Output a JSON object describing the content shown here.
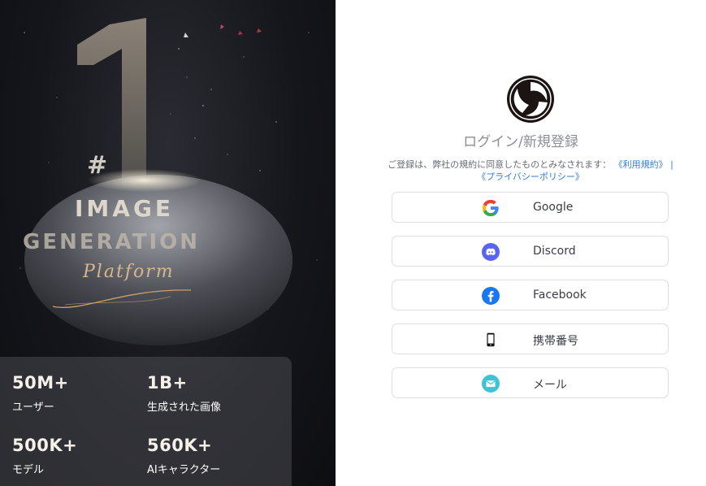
{
  "promo": {
    "hero": {
      "number": "1",
      "hash": "#",
      "line1": "IMAGE",
      "line2": "GENERATION",
      "line3": "Platform"
    },
    "stats": [
      {
        "value": "50M+",
        "label": "ユーザー"
      },
      {
        "value": "1B+",
        "label": "生成された画像"
      },
      {
        "value": "500K+",
        "label": "モデル"
      },
      {
        "value": "560K+",
        "label": "AIキャラクター"
      }
    ]
  },
  "login": {
    "title": "ログイン/新規登録",
    "terms_text": "ご登録は、弊社の規約に同意したものとみなされます：",
    "terms_link": "《利用規約》",
    "separator": " | ",
    "privacy_link": "《プライバシーポリシー》",
    "buttons": [
      {
        "label": "Google",
        "icon": "google-icon"
      },
      {
        "label": "Discord",
        "icon": "discord-icon",
        "color": "#5865F2"
      },
      {
        "label": "Facebook",
        "icon": "facebook-icon",
        "color": "#1877F2"
      },
      {
        "label": "携帯番号",
        "icon": "mobile-phone-icon"
      },
      {
        "label": "メール",
        "icon": "mail-icon",
        "color": "#3cc4d6"
      }
    ]
  }
}
